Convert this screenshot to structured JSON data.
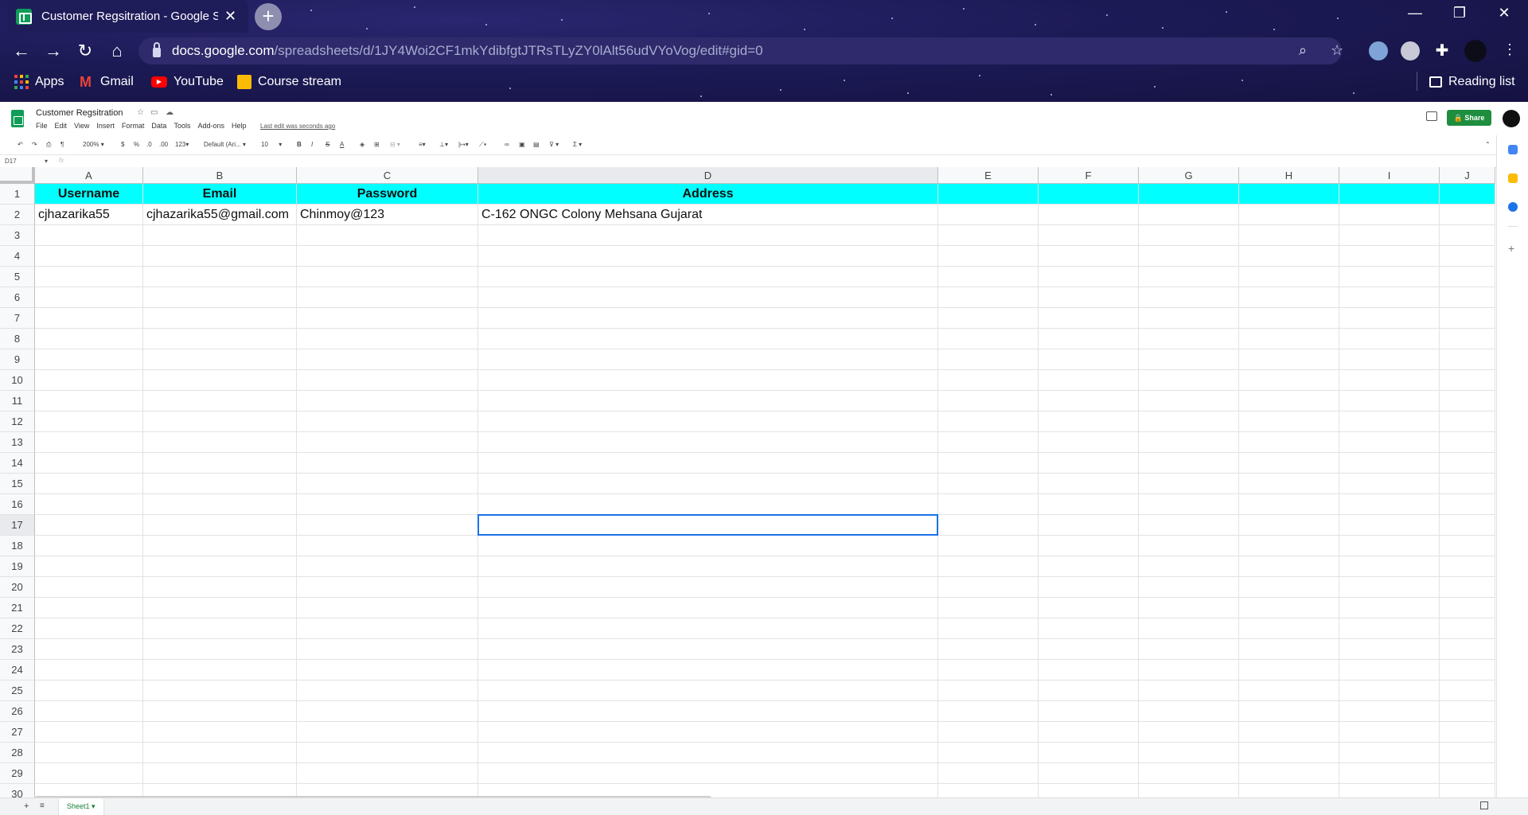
{
  "browser": {
    "tab_title": "Customer Regsitration - Google S",
    "url_host": "docs.google.com",
    "url_path": "/spreadsheets/d/1JY4Woi2CF1mkYdibfgtJTRsTLyZY0lAlt56udVYoVog/edit#gid=0",
    "bookmarks": [
      "Apps",
      "Gmail",
      "YouTube",
      "Course stream"
    ],
    "reading_list": "Reading list"
  },
  "doc": {
    "title": "Customer Regsitration",
    "menu": [
      "File",
      "Edit",
      "View",
      "Insert",
      "Format",
      "Data",
      "Tools",
      "Add-ons",
      "Help"
    ],
    "last_edit": "Last edit was seconds ago",
    "share_label": "Share"
  },
  "toolbar": {
    "zoom": "200%",
    "currency": "$",
    "percent": "%",
    "dec_decrease": ".0",
    "dec_increase": ".00",
    "more_formats": "123",
    "font": "Default (Ari...",
    "font_size": "10",
    "bold": "B",
    "italic": "I",
    "strike": "S",
    "text_color": "A",
    "sum": "Σ"
  },
  "formula_bar": {
    "name_box": "D17",
    "fx": "fx",
    "content": ""
  },
  "grid": {
    "columns": [
      "A",
      "B",
      "C",
      "D",
      "E",
      "F",
      "G",
      "H",
      "I",
      "J"
    ],
    "rows": [
      "1",
      "2",
      "3",
      "4",
      "5",
      "6",
      "7",
      "8",
      "9",
      "10",
      "11",
      "12",
      "13",
      "14",
      "15",
      "16",
      "17",
      "18",
      "19",
      "20",
      "21",
      "22",
      "23",
      "24",
      "25",
      "26",
      "27",
      "28",
      "29",
      "30"
    ],
    "header_row": [
      "Username",
      "Email",
      "Password",
      "Address"
    ],
    "data_row": [
      "cjhazarika55",
      "cjhazarika55@gmail.com",
      "Chinmoy@123",
      "C-162 ONGC Colony Mehsana Gujarat"
    ],
    "selected_cell": "D17",
    "header_fill": "#00ffff"
  },
  "sheets": {
    "active_tab": "Sheet1"
  },
  "colors": {
    "browser_bg": "#1c1a55",
    "share_green": "#1e8e3e",
    "selection_blue": "#1a73e8"
  }
}
